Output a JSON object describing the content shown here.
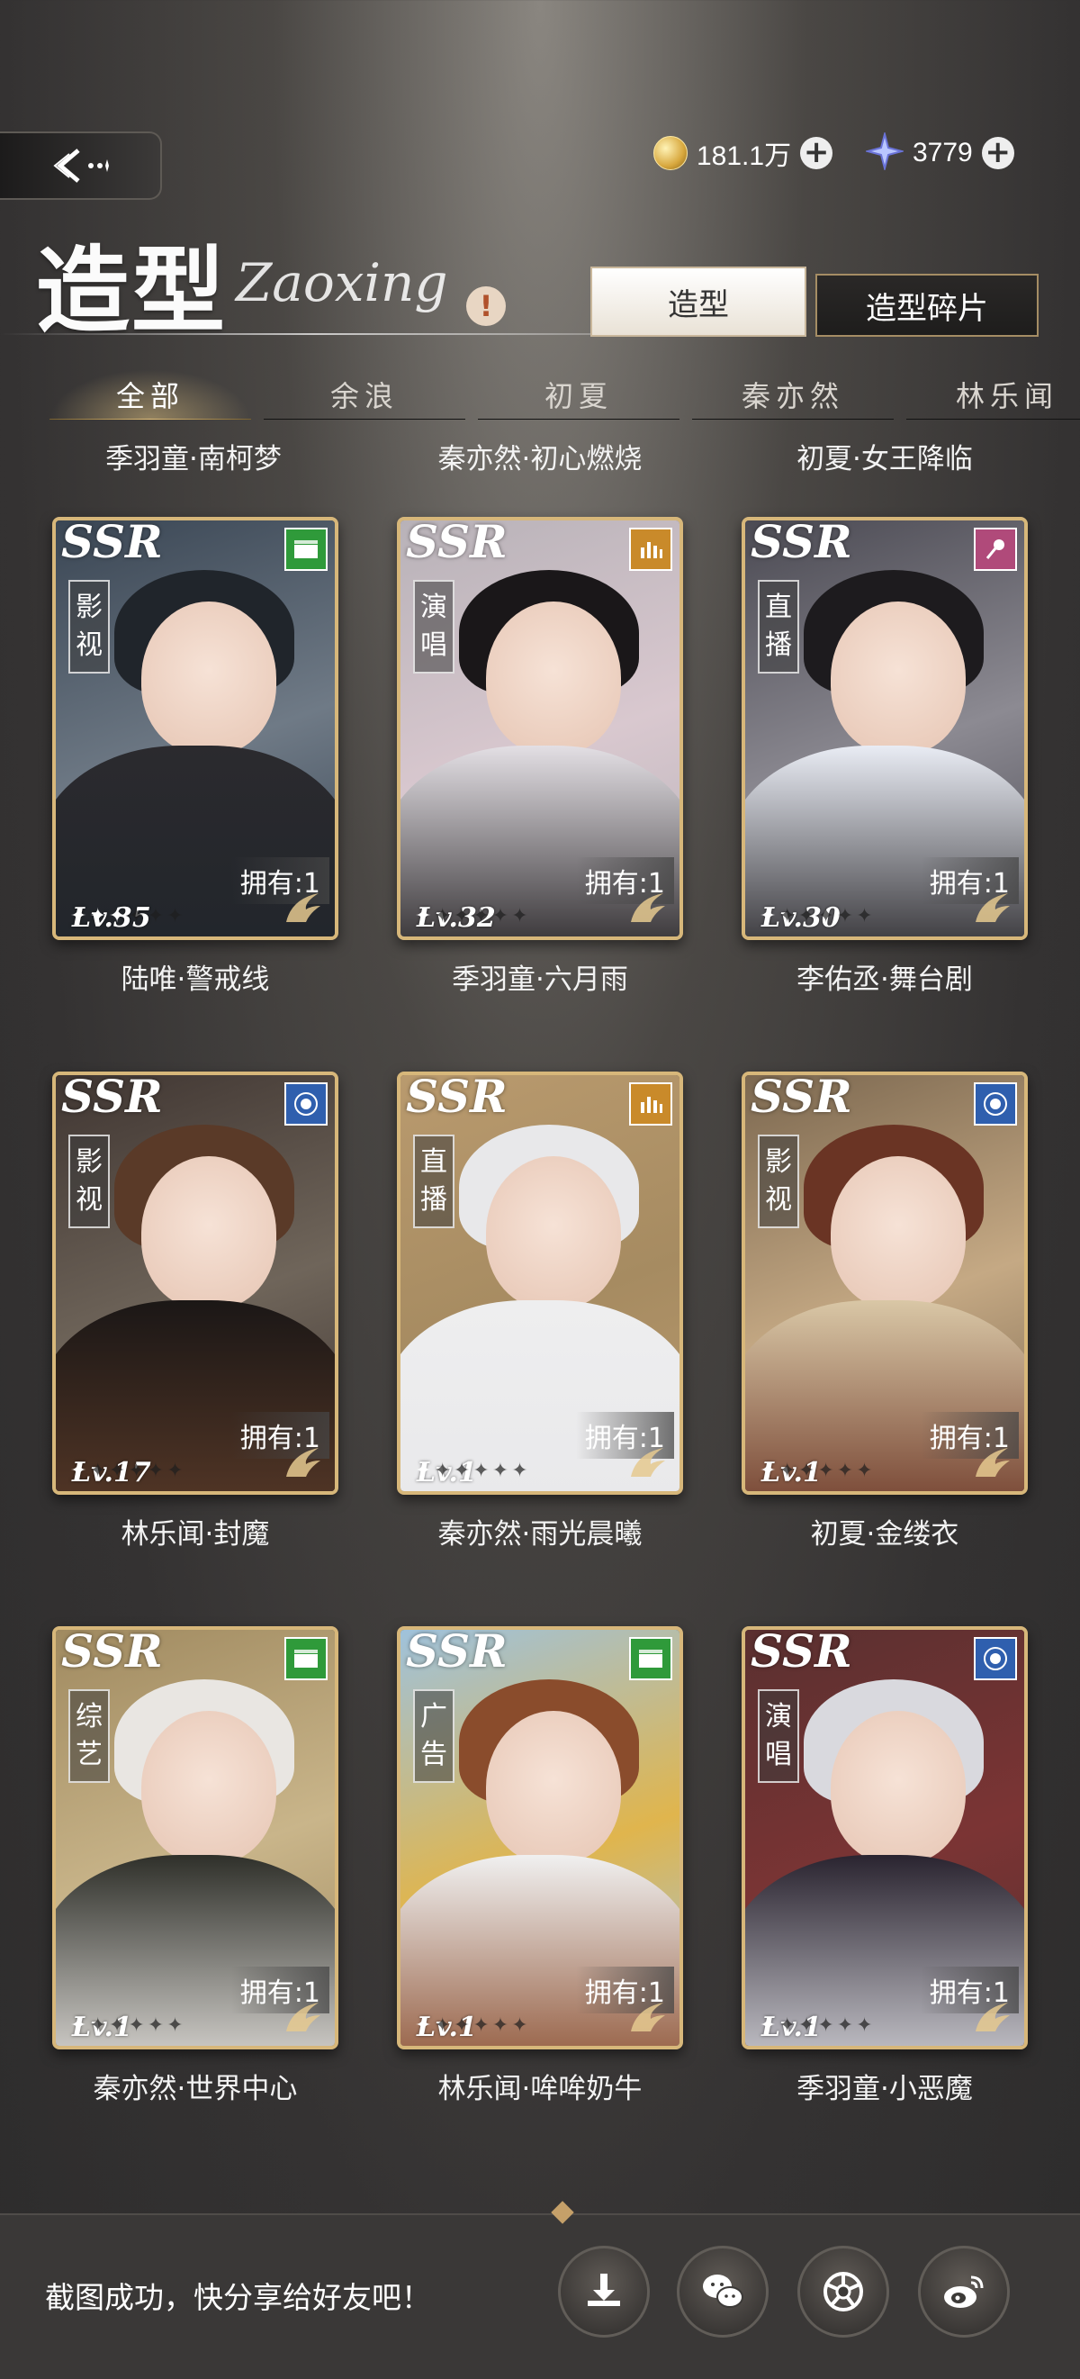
{
  "header": {
    "title": "造型",
    "subtitle": "Zaoxing",
    "info_symbol": "!",
    "back_icon": "back-arrow-icon"
  },
  "currency": {
    "coins": "181.1万",
    "stars": "3779",
    "plus": "+"
  },
  "segment": {
    "active": "造型",
    "inactive": "造型碎片"
  },
  "tabs": [
    "全部",
    "余浪",
    "初夏",
    "秦亦然",
    "林乐闻"
  ],
  "top_names": [
    "季羽童·南柯梦",
    "秦亦然·初心燃烧",
    "初夏·女王降临"
  ],
  "cards": [
    {
      "rarity": "SSR",
      "category": "影视",
      "type_icon": "film-icon",
      "owned": "拥有:1",
      "level": "Lv.35",
      "name": "陆唯·警戒线",
      "stars_lit": 3
    },
    {
      "rarity": "SSR",
      "category": "演唱",
      "type_icon": "bars-icon",
      "owned": "拥有:1",
      "level": "Lv.32",
      "name": "季羽童·六月雨",
      "stars_lit": 1
    },
    {
      "rarity": "SSR",
      "category": "直播",
      "type_icon": "microphone-icon",
      "owned": "拥有:1",
      "level": "Lv.30",
      "name": "李佑丞·舞台剧",
      "stars_lit": 1
    },
    {
      "rarity": "SSR",
      "category": "影视",
      "type_icon": "eye-icon",
      "owned": "拥有:1",
      "level": "Lv.17",
      "name": "林乐闻·封魔",
      "stars_lit": 1
    },
    {
      "rarity": "SSR",
      "category": "直播",
      "type_icon": "bars-icon",
      "owned": "拥有:1",
      "level": "Lv.1",
      "name": "秦亦然·雨光晨曦",
      "stars_lit": 1
    },
    {
      "rarity": "SSR",
      "category": "影视",
      "type_icon": "eye-icon",
      "owned": "拥有:1",
      "level": "Lv.1",
      "name": "初夏·金缕衣",
      "stars_lit": 1
    },
    {
      "rarity": "SSR",
      "category": "综艺",
      "type_icon": "film-icon",
      "owned": "拥有:1",
      "level": "Lv.1",
      "name": "秦亦然·世界中心",
      "stars_lit": 1
    },
    {
      "rarity": "SSR",
      "category": "广告",
      "type_icon": "film-icon",
      "owned": "拥有:1",
      "level": "Lv.1",
      "name": "林乐闻·哞哞奶牛",
      "stars_lit": 1
    },
    {
      "rarity": "SSR",
      "category": "演唱",
      "type_icon": "eye-icon",
      "owned": "拥有:1",
      "level": "Lv.1",
      "name": "季羽童·小恶魔",
      "stars_lit": 1
    }
  ],
  "share": {
    "text": "截图成功，快分享给好友吧！",
    "buttons": [
      "download-icon",
      "wechat-icon",
      "moments-icon",
      "weibo-icon"
    ]
  },
  "colors": {
    "card_border": "#d7b77a",
    "film_badge": "#2f9a3a",
    "bars_badge": "#c98a2a",
    "mic_badge": "#b04a7a",
    "eye_badge": "#2f5fae"
  }
}
